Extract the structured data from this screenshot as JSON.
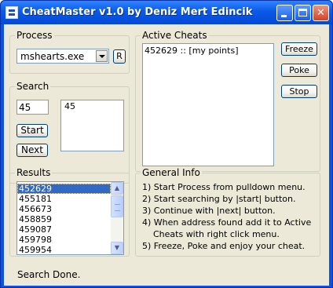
{
  "window": {
    "title": "CheatMaster v1.0 by Deniz Mert Edincik",
    "minimize": "minimize",
    "maximize": "maximize",
    "close": "✕"
  },
  "process": {
    "label": "Process",
    "selected": "mshearts.exe",
    "refresh_label": "R"
  },
  "active_cheats": {
    "label": "Active Cheats",
    "items": [
      "452629 :: [my points]"
    ],
    "freeze_label": "Freeze",
    "poke_label": "Poke",
    "stop_label": "Stop"
  },
  "search": {
    "label": "Search",
    "value": "45",
    "list_items": [
      "45"
    ],
    "start_label": "Start",
    "next_label": "Next"
  },
  "results": {
    "label": "Results",
    "items": [
      "452629",
      "455181",
      "456673",
      "458859",
      "459087",
      "459798",
      "459954"
    ],
    "selected_index": 0
  },
  "general_info": {
    "label": "General Info",
    "lines": [
      "1) Start Process from pulldown menu.",
      "2) Start searching by |start| button.",
      "3) Continue with |next| button.",
      "4) When address found add it to Active",
      "    Cheats with right click menu.",
      "5) Freeze, Poke and enjoy your cheat."
    ]
  },
  "status": {
    "text": "Search Done."
  },
  "colors": {
    "titlebar": "#0a5ae8",
    "face": "#ece9d8",
    "selection": "#316ac5"
  }
}
